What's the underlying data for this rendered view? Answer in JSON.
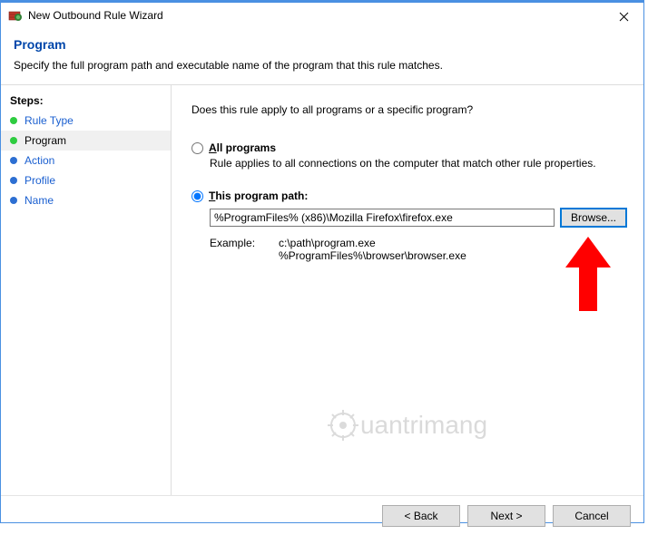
{
  "window": {
    "title": "New Outbound Rule Wizard"
  },
  "header": {
    "heading": "Program",
    "description": "Specify the full program path and executable name of the program that this rule matches."
  },
  "sidebar": {
    "title": "Steps:",
    "items": [
      {
        "label": "Rule Type",
        "state": "done"
      },
      {
        "label": "Program",
        "state": "active"
      },
      {
        "label": "Action",
        "state": "pending"
      },
      {
        "label": "Profile",
        "state": "pending"
      },
      {
        "label": "Name",
        "state": "pending"
      }
    ]
  },
  "content": {
    "question": "Does this rule apply to all programs or a specific program?",
    "option_all": {
      "label_pre": "",
      "label_u": "A",
      "label_post": "ll programs",
      "description": "Rule applies to all connections on the computer that match other rule properties."
    },
    "option_path": {
      "label_pre": "",
      "label_u": "T",
      "label_post": "his program path:",
      "value": "%ProgramFiles% (x86)\\Mozilla Firefox\\firefox.exe",
      "browse_label": "Browse...",
      "example_label": "Example:",
      "example_lines": "c:\\path\\program.exe\n%ProgramFiles%\\browser\\browser.exe"
    },
    "selected": "path"
  },
  "footer": {
    "back": "< Back",
    "next": "Next >",
    "cancel": "Cancel"
  },
  "watermark": "uantrimang"
}
